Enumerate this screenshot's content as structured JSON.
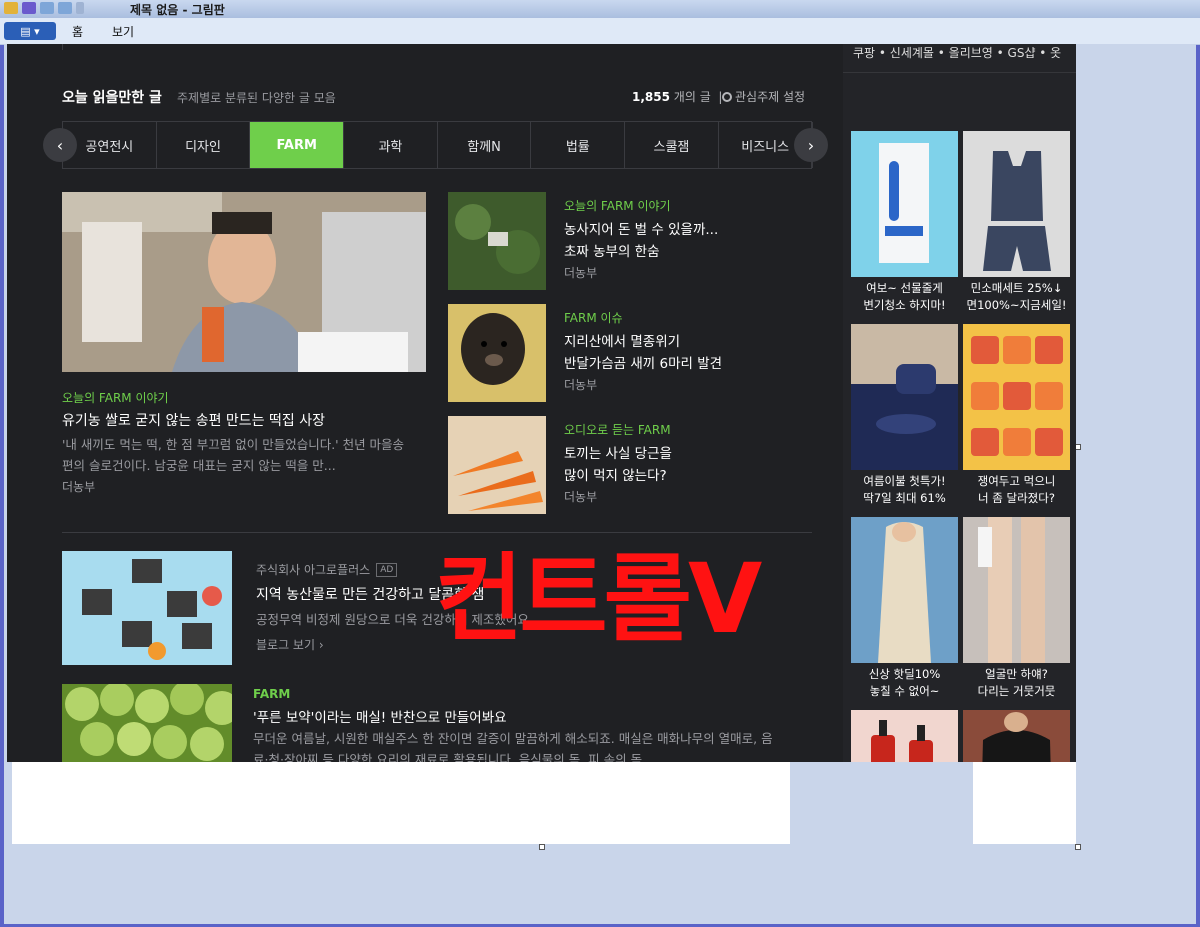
{
  "window": {
    "title": "제목 없음 - 그림판",
    "file_button_label": "▤ ▾",
    "tabs": [
      "홈",
      "보기"
    ]
  },
  "section": {
    "title": "오늘 읽을만한 글",
    "subtitle": "주제별로 분류된 다양한 글 모음",
    "count_number": "1,855",
    "count_suffix": "개의 글",
    "settings_label": "관심주제 설정"
  },
  "categories": [
    "공연전시",
    "디자인",
    "FARM",
    "과학",
    "함께N",
    "법률",
    "스쿨잼",
    "비즈니스"
  ],
  "active_category": "FARM",
  "feature": {
    "label": "오늘의 FARM 이야기",
    "title": "유기농 쌀로 굳지 않는 송편 만드는 떡집 사장",
    "desc": "'내 새끼도 먹는 떡, 한 점 부끄럼 없이 만들었습니다.' 천년 마을송편의 슬로건이다. 남궁윤 대표는 굳지 않는 떡을 만...",
    "source": "더농부"
  },
  "side_articles": [
    {
      "label": "오늘의 FARM 이야기",
      "line1": "농사지어 돈 벌 수 있을까...",
      "line2": "초짜 농부의 한숨",
      "source": "더농부"
    },
    {
      "label": "FARM 이슈",
      "line1": "지리산에서 멸종위기",
      "line2": "반달가슴곰 새끼 6마리 발견",
      "source": "더농부"
    },
    {
      "label": "오디오로 듣는 FARM",
      "line1": "토끼는 사실 당근을",
      "line2": "많이 먹지 않는다?",
      "source": "더농부"
    }
  ],
  "ad": {
    "company": "주식회사 아그로플러스",
    "badge": "AD",
    "title": "지역 농산물로 만든 건강하고 달콤한 잼",
    "desc": "공정무역 비정제 원당으로 더욱 건강하게 제조했어요",
    "link": "블로그 보기 ›"
  },
  "article2": {
    "label": "FARM",
    "title": "'푸른 보약'이라는 매실! 반찬으로 만들어봐요",
    "desc": "무더운 여름날, 시원한 매실주스 한 잔이면 갈증이 말끔하게 해소되죠. 매실은 매화나무의 열매로, 음료·청·장아찌 등 다양한 요리의 재료로 활용됩니다. 음식물의 독, 피 속의 독, ..."
  },
  "overlay_text": "컨트롤V",
  "right_column": {
    "top_links": "쿠팡 • 신세계몰 • 올리브영 • GS샵 • 옷",
    "ads": [
      {
        "line1": "여보~ 선물줄게",
        "line2": "변기청소 하지마!"
      },
      {
        "line1": "민소매세트 25%↓",
        "line2": "면100%~지금세일!"
      },
      {
        "line1": "여름이불 첫특가!",
        "line2": "딱7일 최대 61%"
      },
      {
        "line1": "쟁여두고 먹으니",
        "line2": "너 좀 달라졌다?"
      },
      {
        "line1": "신상 핫딜10%",
        "line2": "놓칠 수 없어~"
      },
      {
        "line1": "얼굴만 하얘?",
        "line2": "다리는 거뭇거뭇"
      }
    ]
  },
  "colors": {
    "accent_green": "#6fcf4b",
    "dark_bg": "#1f2023",
    "overlay_red": "#ff1212"
  }
}
